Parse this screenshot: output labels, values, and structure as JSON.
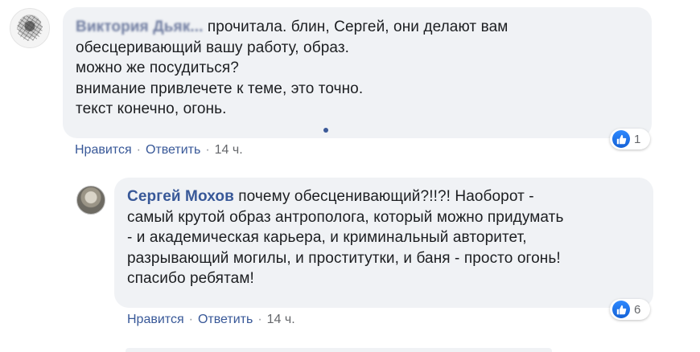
{
  "comments": [
    {
      "author": "Виктория Дьяк...",
      "lines": [
        "прочитала. блин, Сергей, они делают вам",
        "обесцеривающий вашу работу, образ.",
        "можно же посудиться?",
        "внимание привлечете к теме, это точно.",
        "текст конечно, огонь."
      ],
      "like_label": "Нравится",
      "reply_label": "Ответить",
      "separator": "·",
      "time": "14 ч.",
      "reactions_count": "1",
      "reaction_icon": "like-icon"
    },
    {
      "author": "Сергей Мохов",
      "lines": [
        "почему обесценивающий?!!?! Наоборот -",
        "самый крутой образ антрополога, который можно придумать",
        "- и академическая карьера, и криминальный авторитет,",
        "разрывающий могилы, и проститутки, и баня - просто огонь!",
        "спасибо ребятам!"
      ],
      "like_label": "Нравится",
      "reply_label": "Ответить",
      "separator": "·",
      "time": "14 ч.",
      "reactions_count": "6",
      "reaction_icon": "like-icon"
    }
  ],
  "colors": {
    "bubble": "#f0f2f5",
    "author": "#385898",
    "action_link": "#385898",
    "like_blue": "#1877f2"
  }
}
